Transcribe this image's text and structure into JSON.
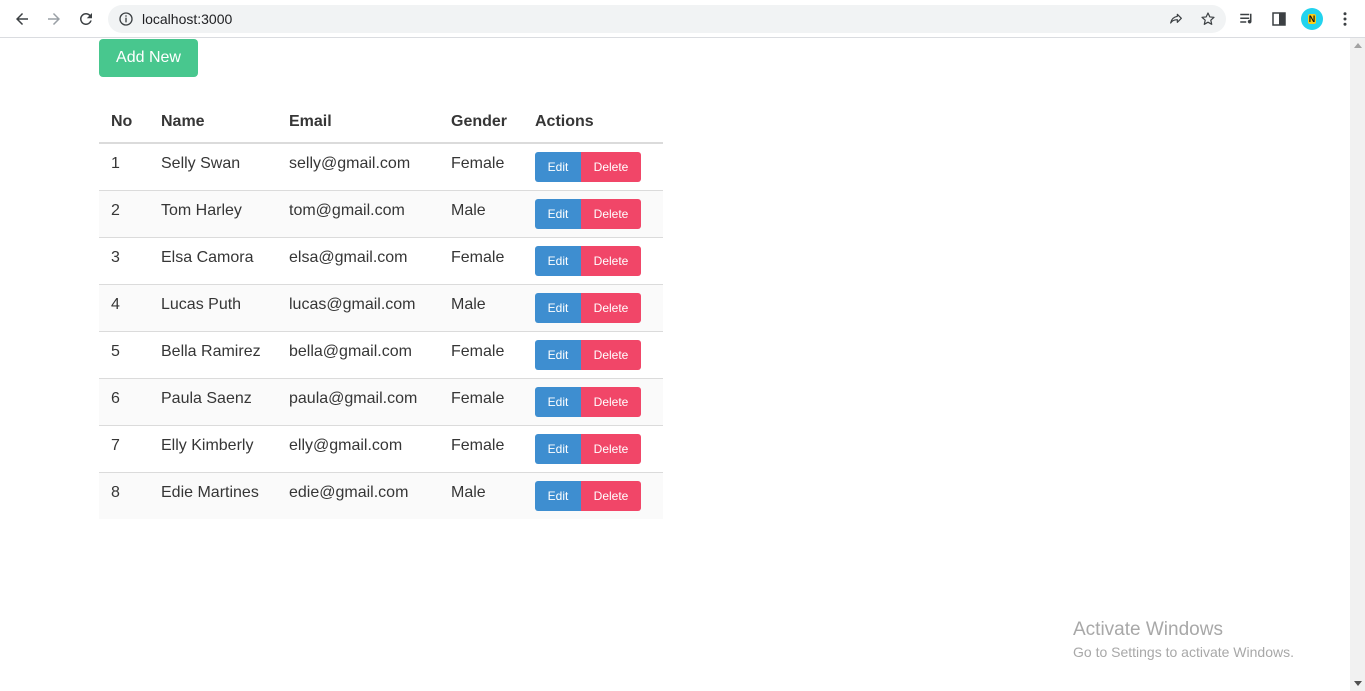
{
  "browser": {
    "url": "localhost:3000"
  },
  "page": {
    "add_button_label": "Add New",
    "table": {
      "headers": [
        "No",
        "Name",
        "Email",
        "Gender",
        "Actions"
      ],
      "rows": [
        {
          "no": "1",
          "name": "Selly Swan",
          "email": "selly@gmail.com",
          "gender": "Female"
        },
        {
          "no": "2",
          "name": "Tom Harley",
          "email": "tom@gmail.com",
          "gender": "Male"
        },
        {
          "no": "3",
          "name": "Elsa Camora",
          "email": "elsa@gmail.com",
          "gender": "Female"
        },
        {
          "no": "4",
          "name": "Lucas Puth",
          "email": "lucas@gmail.com",
          "gender": "Male"
        },
        {
          "no": "5",
          "name": "Bella Ramirez",
          "email": "bella@gmail.com",
          "gender": "Female"
        },
        {
          "no": "6",
          "name": "Paula Saenz",
          "email": "paula@gmail.com",
          "gender": "Female"
        },
        {
          "no": "7",
          "name": "Elly Kimberly",
          "email": "elly@gmail.com",
          "gender": "Female"
        },
        {
          "no": "8",
          "name": "Edie Martines",
          "email": "edie@gmail.com",
          "gender": "Male"
        }
      ],
      "edit_label": "Edit",
      "delete_label": "Delete"
    }
  },
  "watermark": {
    "title": "Activate Windows",
    "subtitle": "Go to Settings to activate Windows."
  },
  "colors": {
    "add_button": "#48c78e",
    "edit_button": "#3e8ed0",
    "delete_button": "#f14668"
  },
  "icons": [
    "back-arrow-icon",
    "forward-arrow-icon",
    "reload-icon",
    "info-icon",
    "share-icon",
    "star-icon",
    "reading-list-icon",
    "side-panel-icon",
    "kebab-menu-icon"
  ]
}
